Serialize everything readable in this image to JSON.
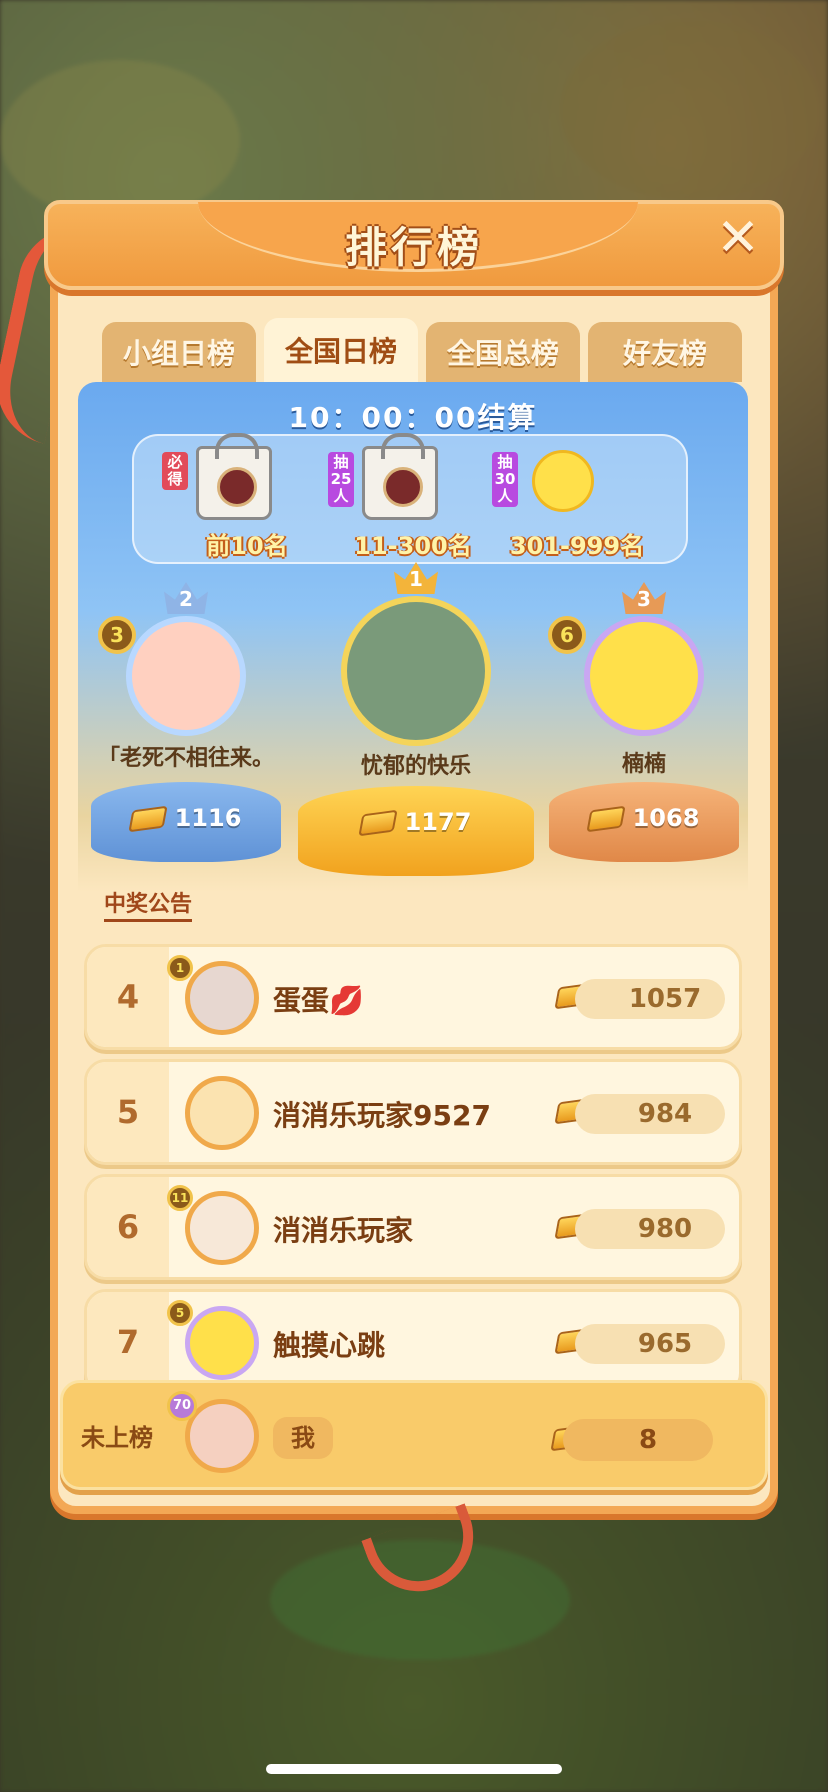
{
  "panel": {
    "title": "排行榜",
    "close_icon": "close-icon"
  },
  "tabs": [
    {
      "label": "小组日榜",
      "active": false
    },
    {
      "label": "全国日榜",
      "active": true
    },
    {
      "label": "全国总榜",
      "active": false
    },
    {
      "label": "好友榜",
      "active": false
    }
  ],
  "countdown": "10：00：00结算",
  "prizes": [
    {
      "tag": "必得",
      "label": "前10名",
      "icon": "gift-bag-icon",
      "tag_color": "#e24b5a"
    },
    {
      "tag": "抽25人",
      "label": "11-300名",
      "icon": "gift-bag-icon",
      "tag_color": "#b84ae0"
    },
    {
      "tag": "抽30人",
      "label": "301-999名",
      "icon": "chick-icon",
      "tag_color": "#b84ae0"
    }
  ],
  "podium": [
    {
      "place": "2",
      "level": "3",
      "name": "「老死不相往来。",
      "score": "1116"
    },
    {
      "place": "1",
      "level": "",
      "name": "忧郁的快乐",
      "score": "1177"
    },
    {
      "place": "3",
      "level": "6",
      "name": "楠楠",
      "score": "1068"
    }
  ],
  "notice_link": "中奖公告",
  "rows": [
    {
      "rank": "4",
      "level": "1",
      "name": "蛋蛋💋",
      "score": "1057"
    },
    {
      "rank": "5",
      "level": "",
      "name": "消消乐玩家9527",
      "score": "984"
    },
    {
      "rank": "6",
      "level": "11",
      "name": "消消乐玩家",
      "score": "980"
    },
    {
      "rank": "7",
      "level": "5",
      "name": "触摸心跳",
      "score": "965"
    }
  ],
  "me": {
    "rank": "未上榜",
    "level": "70",
    "name": "我",
    "score": "8"
  },
  "colors": {
    "accent": "#f09a3e",
    "panel_bg": "#fce7bf",
    "gold": "#ffd55a"
  }
}
